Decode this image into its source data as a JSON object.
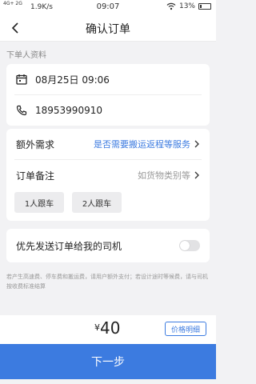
{
  "status_bar": {
    "network": "4G+ 2G",
    "speed": "1.9K/s",
    "time": "09:07",
    "battery": "13%"
  },
  "header": {
    "title": "确认订单",
    "back_icon": "chevron-left-icon"
  },
  "orderer_section": {
    "label": "下单人资料",
    "datetime": "08月25日 09:06",
    "phone": "18953990910",
    "calendar_icon": "calendar-icon",
    "phone_icon": "phone-icon"
  },
  "extra": {
    "demand_label": "额外需求",
    "demand_value": "是否需要搬运返程等服务",
    "remark_label": "订单备注",
    "remark_placeholder": "如货物类别等",
    "chips": [
      "1人跟车",
      "2人跟车"
    ]
  },
  "priority": {
    "label": "优先发送订单给我的司机",
    "enabled": false
  },
  "note": "若产生高速费、停车费和搬运费，请用户额外支付；若设计途时等候费，请与司机按收费标准结算",
  "price_bar": {
    "currency": "¥",
    "amount": "40",
    "detail_label": "价格明细"
  },
  "next_button": {
    "label": "下一步"
  },
  "colors": {
    "accent": "#3c7be0",
    "background": "#f2f2f4"
  }
}
